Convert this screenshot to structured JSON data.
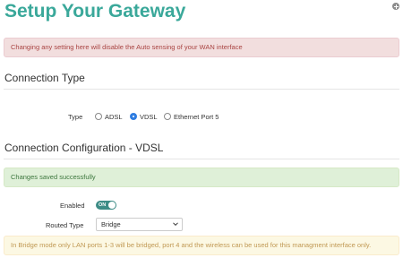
{
  "header": {
    "title": "Setup Your Gateway",
    "add_icon": "plus-circle-icon"
  },
  "alerts": {
    "wan_warning": "Changing any setting here will disable the Auto sensing of your WAN interface",
    "saved": "Changes saved successfully",
    "bridge_info": "In Bridge mode only LAN ports 1-3 will be bridged, port 4 and the wireless can be used for this managment interface only."
  },
  "connection_type": {
    "heading": "Connection Type",
    "label": "Type",
    "options": [
      {
        "label": "ADSL",
        "checked": false
      },
      {
        "label": "VDSL",
        "checked": true
      },
      {
        "label": "Ethernet Port 5",
        "checked": false
      }
    ]
  },
  "connection_config": {
    "heading": "Connection Configuration - VDSL",
    "enabled_label": "Enabled",
    "enabled_toggle": "ON",
    "enabled": true,
    "routed_type_label": "Routed Type",
    "routed_type_value": "Bridge"
  },
  "colors": {
    "title": "#3aa89a",
    "radio_checked": "#2f7de1",
    "toggle_on": "#3d8c86",
    "danger_bg": "#f2dede",
    "success_bg": "#dff0d8",
    "warning_bg": "#fcf8e3"
  }
}
